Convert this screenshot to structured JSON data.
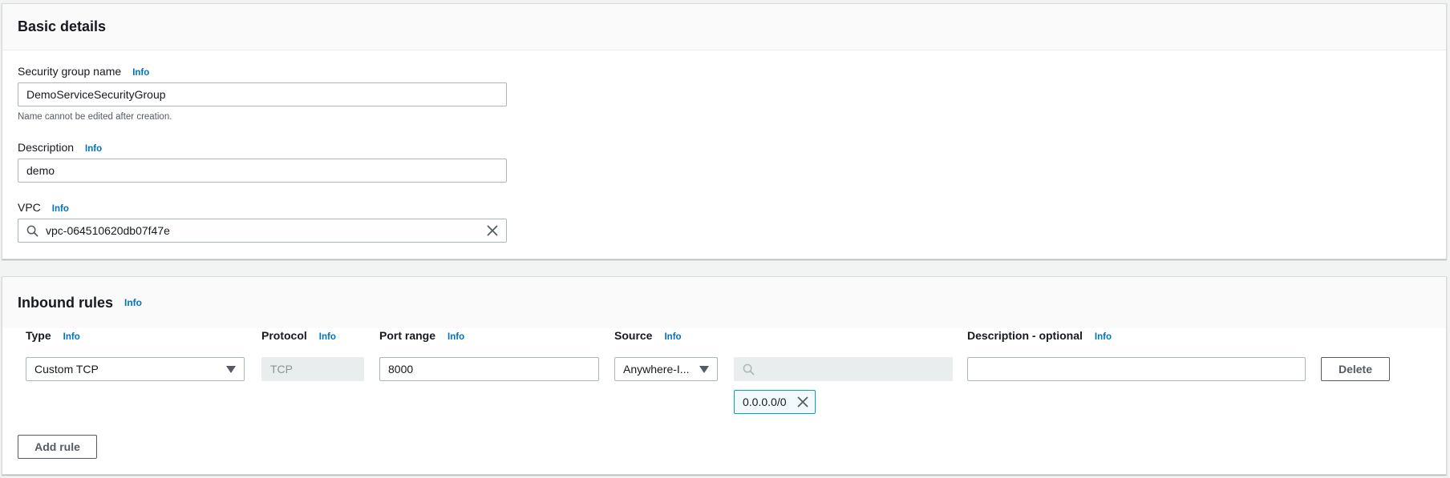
{
  "basic": {
    "title": "Basic details",
    "info": "Info",
    "name_label": "Security group name",
    "name_value": "DemoServiceSecurityGroup",
    "name_constraint": "Name cannot be edited after creation.",
    "description_label": "Description",
    "description_value": "demo",
    "vpc_label": "VPC",
    "vpc_value": "vpc-064510620db07f47e"
  },
  "inbound": {
    "title": "Inbound rules",
    "info": "Info",
    "columns": {
      "type": "Type",
      "protocol": "Protocol",
      "port_range": "Port range",
      "source": "Source",
      "description": "Description - optional"
    },
    "rule": {
      "type": "Custom TCP",
      "protocol": "TCP",
      "port_range": "8000",
      "source": "Anywhere-I...",
      "source_cidr": "0.0.0.0/0",
      "description": ""
    },
    "delete_label": "Delete",
    "add_rule_label": "Add rule"
  },
  "colors": {
    "link": "#0073bb",
    "token_border": "#00a1c9",
    "token_bg": "#f1faff"
  }
}
